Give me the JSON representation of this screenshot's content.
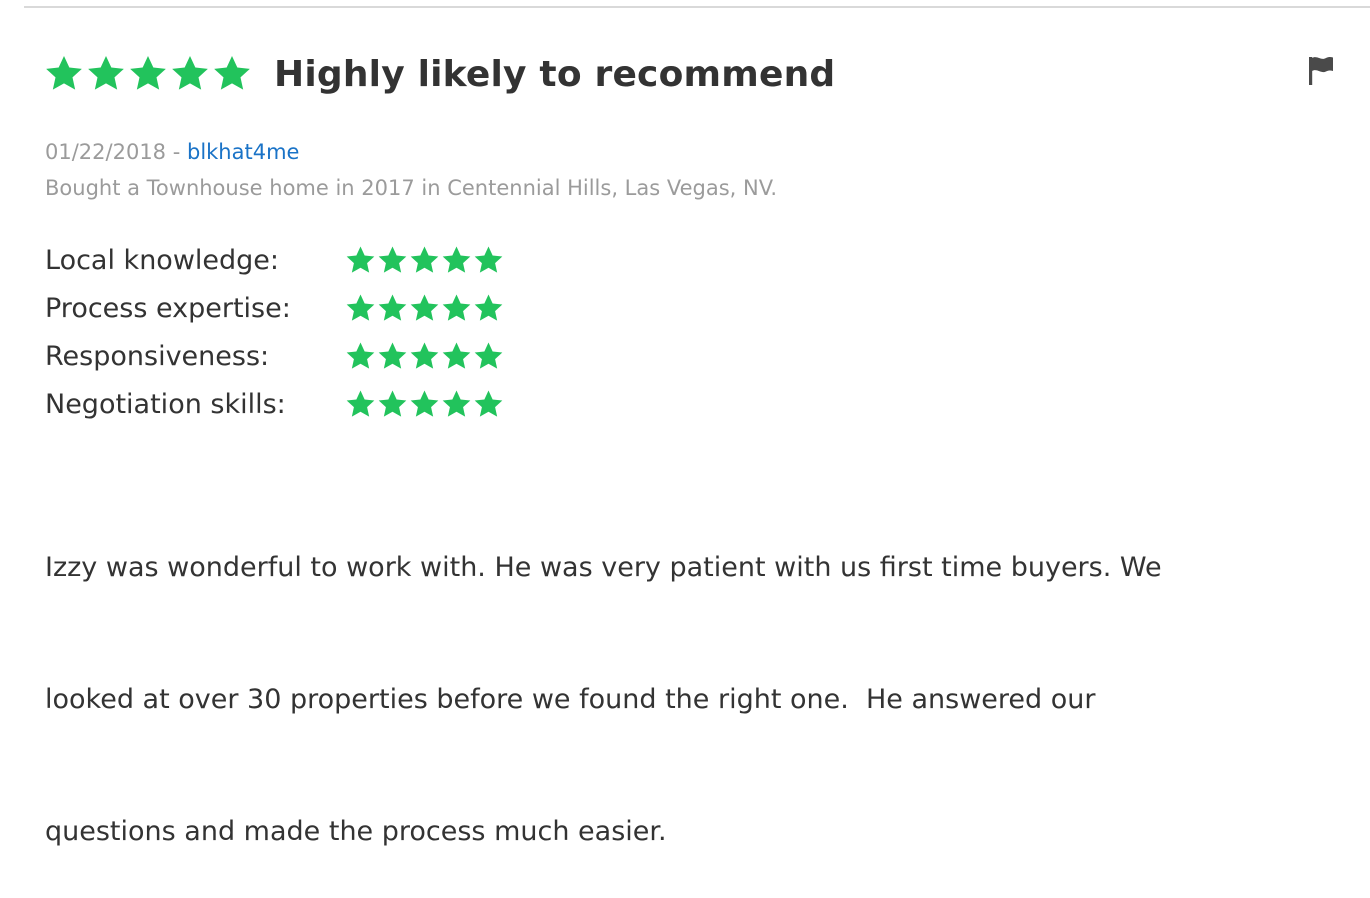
{
  "review": {
    "overall_rating": 5,
    "title": "Highly likely to recommend",
    "date": "01/22/2018",
    "separator": " - ",
    "author": "blkhat4me",
    "purchase_info": "Bought a Townhouse home in 2017 in Centennial Hills, Las Vegas, NV.",
    "ratings": [
      {
        "label": "Local knowledge:",
        "stars": 5
      },
      {
        "label": "Process expertise:",
        "stars": 5
      },
      {
        "label": "Responsiveness:",
        "stars": 5
      },
      {
        "label": "Negotiation skills:",
        "stars": 5
      }
    ],
    "body_lines": [
      "Izzy was wonderful to work with. He was very patient with us first time buyers. We",
      "looked at over 30 properties before we found the right one.  He answered our",
      "questions and made the process much easier."
    ]
  },
  "icons": {
    "star": "star-icon",
    "flag": "flag-icon"
  },
  "colors": {
    "star": "#22c35c",
    "link": "#1a73c7",
    "muted": "#9b9b9b",
    "text": "#333333"
  }
}
